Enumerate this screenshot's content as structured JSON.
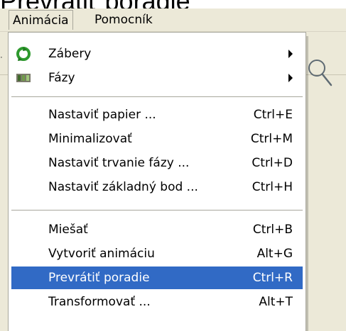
{
  "page": {
    "heading": "Prevrátiť poradie"
  },
  "menubar": {
    "items": [
      {
        "label": "Animácia"
      },
      {
        "label": "Pomocník"
      }
    ]
  },
  "menu": {
    "submenu_items": [
      {
        "label": "Zábery",
        "icon": "green-cycle-icon"
      },
      {
        "label": "Fázy",
        "icon": "film-frames-icon"
      }
    ],
    "group1": [
      {
        "label": "Nastaviť papier ...",
        "shortcut": "Ctrl+E"
      },
      {
        "label": "Minimalizovať",
        "shortcut": "Ctrl+M"
      },
      {
        "label": "Nastaviť trvanie fázy ...",
        "shortcut": "Ctrl+D"
      },
      {
        "label": "Nastaviť základný bod ...",
        "shortcut": "Ctrl+H"
      }
    ],
    "group2": [
      {
        "label": "Miešať",
        "shortcut": "Ctrl+B"
      },
      {
        "label": "Vytvoriť animáciu",
        "shortcut": "Alt+G"
      },
      {
        "label": "Prevrátiť poradie",
        "shortcut": "Ctrl+R"
      },
      {
        "label": "Transformovať ...",
        "shortcut": "Alt+T"
      }
    ]
  },
  "colors": {
    "highlight": "#316ac5",
    "menubar_bg": "#ece9d8"
  }
}
